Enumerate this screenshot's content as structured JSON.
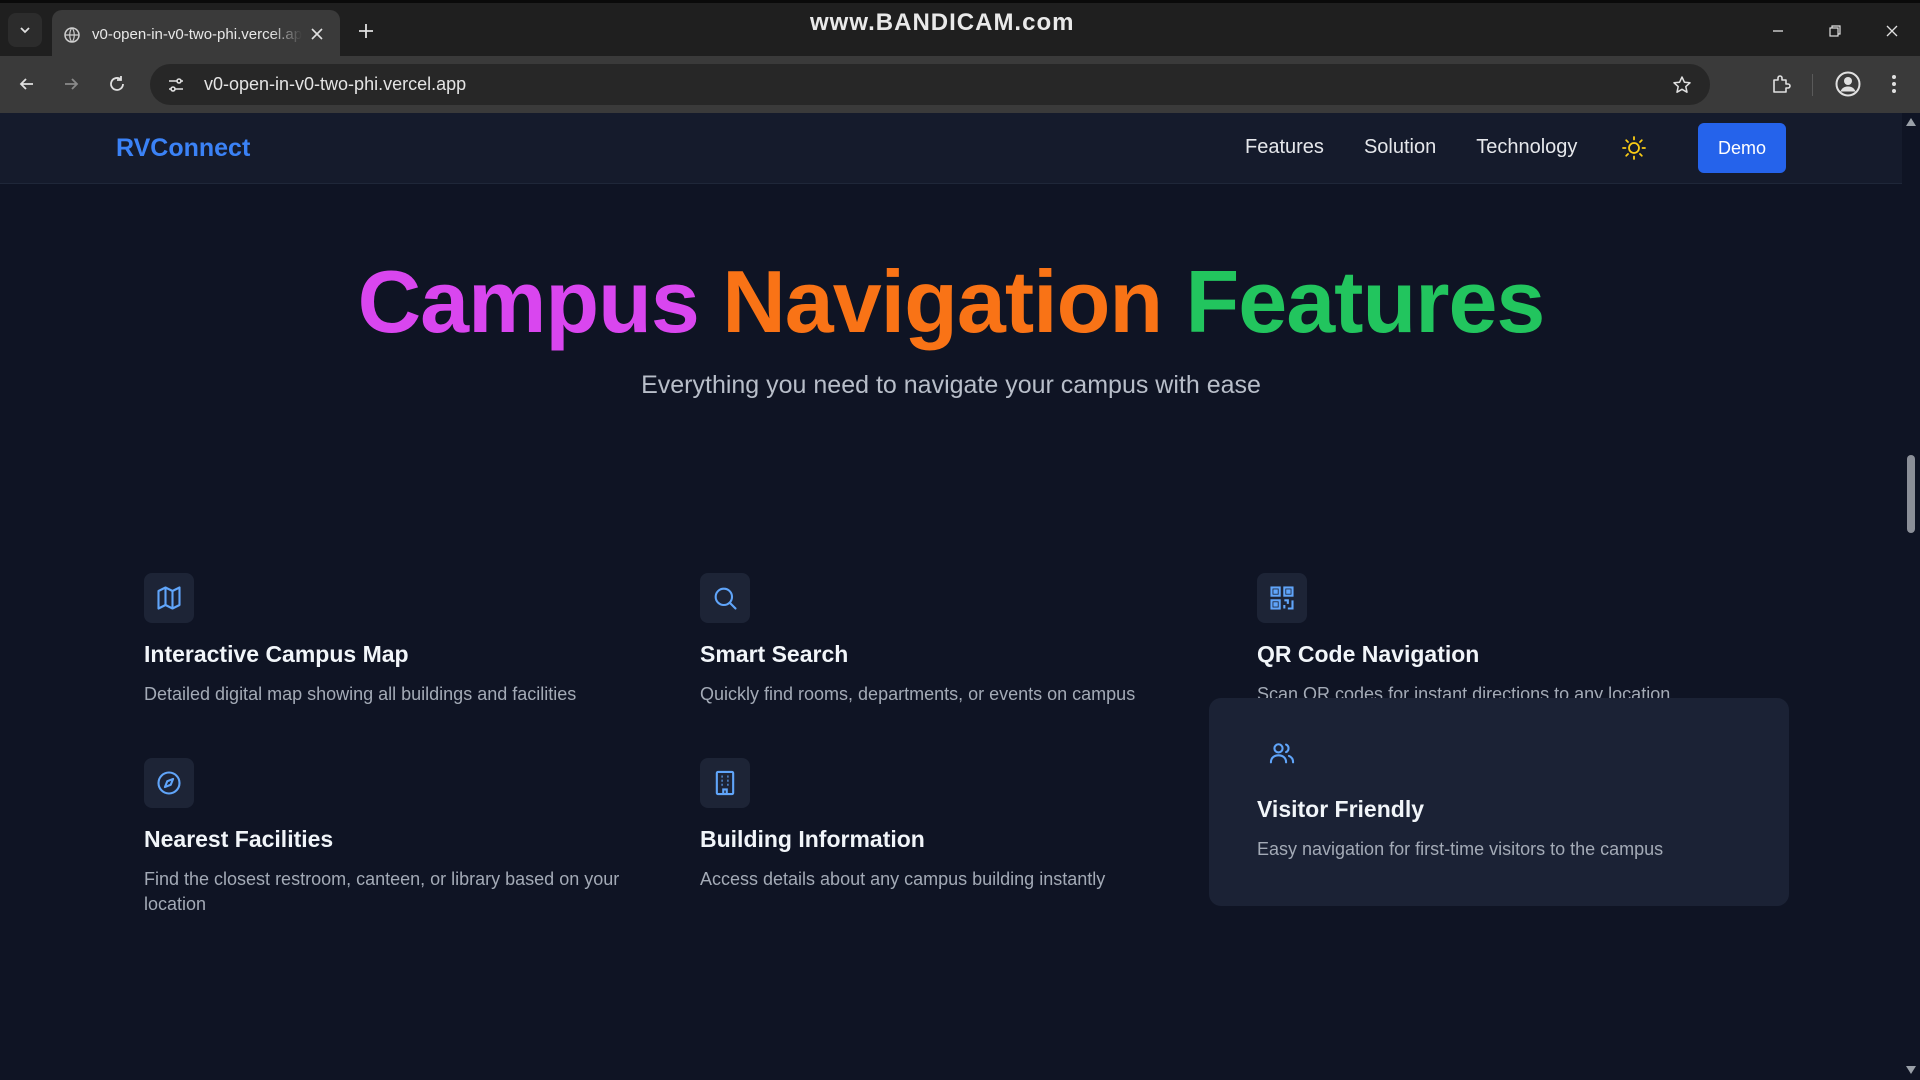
{
  "browser": {
    "tab_title": "v0-open-in-v0-two-phi.vercel.app",
    "url": "v0-open-in-v0-two-phi.vercel.app",
    "watermark": "www.BANDICAM.com"
  },
  "site": {
    "brand": "RVConnect",
    "nav": [
      "Features",
      "Solution",
      "Technology"
    ],
    "demo_label": "Demo"
  },
  "hero": {
    "title_words": [
      "Campus",
      "Navigation",
      "Features"
    ],
    "subtitle": "Everything you need to navigate your campus with ease"
  },
  "features": [
    {
      "icon": "map-icon",
      "title": "Interactive Campus Map",
      "desc": "Detailed digital map showing all buildings and facilities"
    },
    {
      "icon": "search-icon",
      "title": "Smart Search",
      "desc": "Quickly find rooms, departments, or events on campus"
    },
    {
      "icon": "qr-code-icon",
      "title": "QR Code Navigation",
      "desc": "Scan QR codes for instant directions to any location"
    },
    {
      "icon": "compass-icon",
      "title": "Nearest Facilities",
      "desc": "Find the closest restroom, canteen, or library based on your location"
    },
    {
      "icon": "building-icon",
      "title": "Building Information",
      "desc": "Access details about any campus building instantly"
    },
    {
      "icon": "users-icon",
      "title": "Visitor Friendly",
      "desc": "Easy navigation for first-time visitors to the campus"
    }
  ],
  "colors": {
    "background": "#0f1424",
    "header": "#151b2c",
    "accent": "#3b82f6",
    "demo_button": "#2563eb",
    "theme_icon": "#facc15",
    "highlight_card": "#1b2235"
  }
}
